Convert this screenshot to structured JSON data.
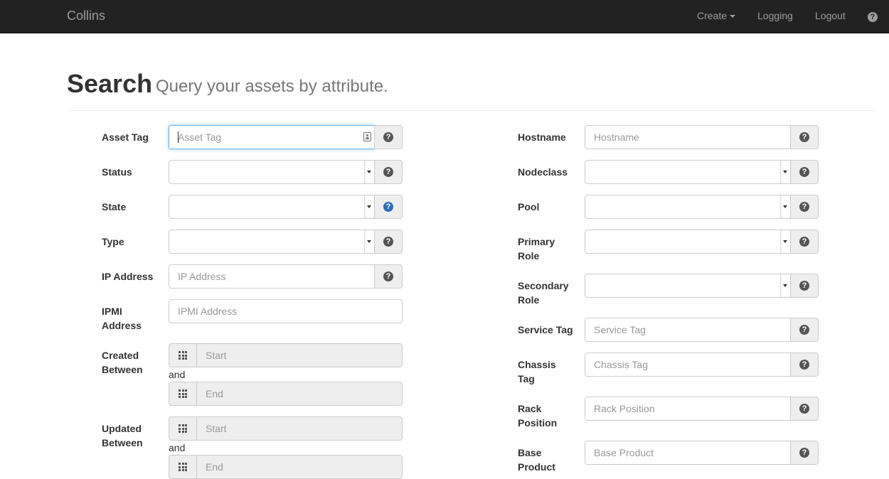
{
  "navbar": {
    "brand": "Collins",
    "create": "Create",
    "logging": "Logging",
    "logout": "Logout",
    "help": "?"
  },
  "header": {
    "title": "Search",
    "subtitle": "Query your assets by attribute."
  },
  "left_form": {
    "asset_tag": {
      "label": "Asset Tag",
      "placeholder": "Asset Tag"
    },
    "status": {
      "label": "Status",
      "value": ""
    },
    "state": {
      "label": "State",
      "value": ""
    },
    "type": {
      "label": "Type",
      "value": ""
    },
    "ip_address": {
      "label": "IP Address",
      "placeholder": "IP Address"
    },
    "ipmi_address": {
      "label_line1": "IPMI",
      "label_line2": "Address",
      "placeholder": "IPMI Address"
    },
    "created_between": {
      "label_line1": "Created",
      "label_line2": "Between",
      "start": "Start",
      "and": "and",
      "end": "End"
    },
    "updated_between": {
      "label_line1": "Updated",
      "label_line2": "Between",
      "start": "Start",
      "and": "and",
      "end": "End"
    }
  },
  "right_form": {
    "hostname": {
      "label": "Hostname",
      "placeholder": "Hostname"
    },
    "nodeclass": {
      "label": "Nodeclass",
      "value": ""
    },
    "pool": {
      "label": "Pool",
      "value": ""
    },
    "primary_role": {
      "label_line1": "Primary",
      "label_line2": "Role",
      "value": ""
    },
    "secondary_role": {
      "label_line1": "Secondary",
      "label_line2": "Role",
      "value": ""
    },
    "service_tag": {
      "label": "Service Tag",
      "placeholder": "Service Tag"
    },
    "chassis_tag": {
      "label_line1": "Chassis",
      "label_line2": "Tag",
      "placeholder": "Chassis Tag"
    },
    "rack_position": {
      "label_line1": "Rack",
      "label_line2": "Position",
      "placeholder": "Rack Position"
    },
    "base_product": {
      "label_line1": "Base",
      "label_line2": "Product",
      "placeholder": "Base Product"
    }
  },
  "icons": {
    "help": "question-circle-icon",
    "calendar": "calendar-grid-icon",
    "contact": "contact-card-icon"
  },
  "colors": {
    "navbar_bg": "#222222",
    "focus_border": "#66afe9",
    "help_active": "#2a6ebb"
  }
}
